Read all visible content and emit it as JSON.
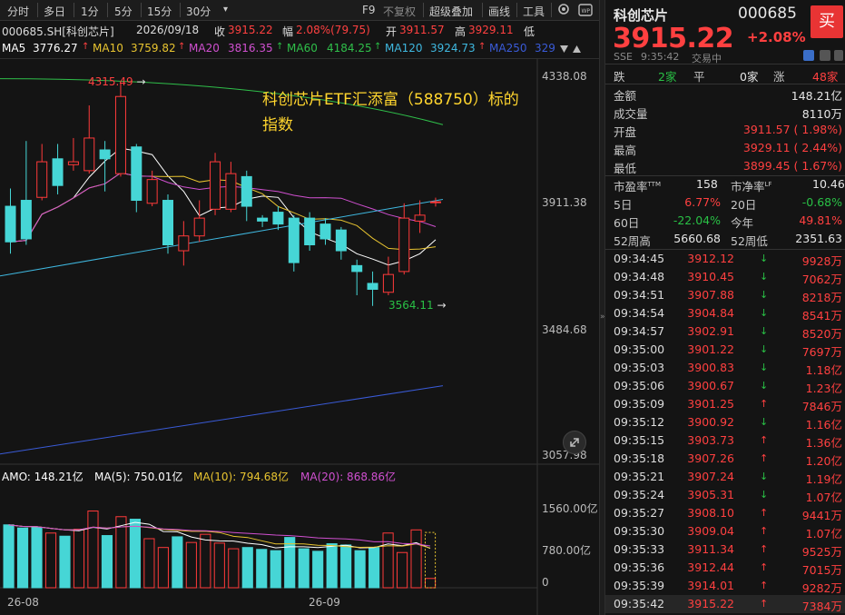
{
  "toolbar": {
    "tabs": [
      "分时",
      "多日",
      "1分",
      "5分",
      "15分",
      "30分"
    ],
    "dropdown": "▾",
    "right": [
      "F9",
      "不复权",
      "超级叠加",
      "画线",
      "工具"
    ]
  },
  "info": {
    "symbol": "000685.SH[科创芯片]",
    "date": "2026/09/18",
    "close_label": "收",
    "close": "3915.22",
    "chg_label": "幅",
    "chg": "2.08%(79.75)",
    "open_label": "开",
    "open": "3911.57",
    "high_label": "高",
    "high": "3929.11",
    "low_label": "低"
  },
  "ma": {
    "ma5_label": "MA5",
    "ma5": "3776.27",
    "ma10_label": "MA10",
    "ma10": "3759.82",
    "ma20_label": "MA20",
    "ma20": "3816.35",
    "ma60_label": "MA60",
    "ma60": "4184.25",
    "ma120_label": "MA120",
    "ma120": "3924.73",
    "ma250_label": "MA250",
    "ma250": "329",
    "arrow": "↑",
    "colors": {
      "ma5": "#ffffff",
      "ma10": "#e8c430",
      "ma20": "#d050d0",
      "ma60": "#2fbf4a",
      "ma120": "#3fb8e0",
      "ma250": "#3a5bd8"
    }
  },
  "chart_data": {
    "type": "candlestick",
    "price_axis": [
      "4338.08",
      "3911.38",
      "3484.68",
      "3057.98"
    ],
    "price_range": [
      3057.98,
      4338.08
    ],
    "max_label": "4315.49",
    "min_label": "3564.11",
    "annotation": "科创芯片ETF汇添富（588750）标的指数",
    "x_labels": [
      "26-08",
      "26-09"
    ],
    "candles": [
      {
        "o": 3900,
        "c": 3780,
        "h": 3960,
        "l": 3740
      },
      {
        "o": 3920,
        "c": 3790,
        "h": 4120,
        "l": 3770
      },
      {
        "o": 3930,
        "c": 4050,
        "h": 4110,
        "l": 3920
      },
      {
        "o": 4060,
        "c": 3970,
        "h": 4110,
        "l": 3940
      },
      {
        "o": 4040,
        "c": 4050,
        "h": 4130,
        "l": 4020
      },
      {
        "o": 4020,
        "c": 4130,
        "h": 4240,
        "l": 4010
      },
      {
        "o": 4090,
        "c": 4060,
        "h": 4120,
        "l": 3950
      },
      {
        "o": 4010,
        "c": 4270,
        "h": 4316,
        "l": 4000
      },
      {
        "o": 4100,
        "c": 3920,
        "h": 4110,
        "l": 3880
      },
      {
        "o": 3910,
        "c": 3990,
        "h": 4020,
        "l": 3900
      },
      {
        "o": 3920,
        "c": 3770,
        "h": 3940,
        "l": 3740
      },
      {
        "o": 3750,
        "c": 3800,
        "h": 3850,
        "l": 3700
      },
      {
        "o": 3800,
        "c": 3860,
        "h": 3920,
        "l": 3780
      },
      {
        "o": 3890,
        "c": 4050,
        "h": 4080,
        "l": 3870
      },
      {
        "o": 3890,
        "c": 4010,
        "h": 4050,
        "l": 3880
      },
      {
        "o": 4000,
        "c": 3900,
        "h": 4020,
        "l": 3850
      },
      {
        "o": 3860,
        "c": 3850,
        "h": 3870,
        "l": 3830
      },
      {
        "o": 3880,
        "c": 3840,
        "h": 3900,
        "l": 3820
      },
      {
        "o": 3860,
        "c": 3710,
        "h": 3870,
        "l": 3680
      },
      {
        "o": 3860,
        "c": 3770,
        "h": 3880,
        "l": 3750
      },
      {
        "o": 3840,
        "c": 3790,
        "h": 3860,
        "l": 3770
      },
      {
        "o": 3820,
        "c": 3750,
        "h": 3830,
        "l": 3720
      },
      {
        "o": 3700,
        "c": 3680,
        "h": 3720,
        "l": 3600
      },
      {
        "o": 3640,
        "c": 3620,
        "h": 3680,
        "l": 3564
      },
      {
        "o": 3610,
        "c": 3670,
        "h": 3730,
        "l": 3600
      },
      {
        "o": 3680,
        "c": 3860,
        "h": 3910,
        "l": 3670
      },
      {
        "o": 3850,
        "c": 3870,
        "h": 3920,
        "l": 3810
      },
      {
        "o": 3912,
        "c": 3915,
        "h": 3929,
        "l": 3899
      }
    ]
  },
  "amo": {
    "label": "AMO: 148.21亿",
    "ma5": "MA(5): 750.01亿",
    "ma10": "MA(10): 794.68亿",
    "ma20": "MA(20): 868.86亿",
    "axis": [
      "1560.00亿",
      "780.00亿",
      "0"
    ],
    "range_max": 1560,
    "bars": [
      1000,
      950,
      960,
      870,
      820,
      930,
      1220,
      830,
      1130,
      1090,
      780,
      640,
      810,
      720,
      850,
      710,
      620,
      640,
      610,
      590,
      800,
      620,
      580,
      700,
      680,
      590,
      640,
      870,
      560,
      920,
      148
    ],
    "colors": {
      "amo": "#ffffff",
      "ma5": "#ffffff",
      "ma10": "#e8c430",
      "ma20": "#d050d0"
    }
  },
  "quote": {
    "name": "科创芯片",
    "code": "000685",
    "buy": "买",
    "price": "3915.22",
    "pct": "+2.08%",
    "exch": "SSE",
    "time": "9:35:42",
    "status": "交易中",
    "breadth": {
      "down_label": "跌",
      "down": "2家",
      "flat_label": "平",
      "flat": "0家",
      "up_label": "涨",
      "up": "48家"
    },
    "stats": [
      {
        "label": "金额",
        "value": "148.21亿",
        "cls": "wht"
      },
      {
        "label": "成交量",
        "value": "8110万",
        "cls": "wht"
      },
      {
        "label": "开盘",
        "value": "3911.57 ( 1.98%)",
        "cls": "red"
      },
      {
        "label": "最高",
        "value": "3929.11 ( 2.44%)",
        "cls": "red"
      },
      {
        "label": "最低",
        "value": "3899.45 ( 1.67%)",
        "cls": "red"
      }
    ],
    "val": {
      "pe_label": "市盈率",
      "pe_sup": "TTM",
      "pe": "158",
      "pb_label": "市净率",
      "pb_sup": "LF",
      "pb": "10.46"
    },
    "perf": [
      {
        "l1": "5日",
        "v1": "6.77%",
        "c1": "red",
        "l2": "20日",
        "v2": "-0.68%",
        "c2": "grn"
      },
      {
        "l1": "60日",
        "v1": "-22.04%",
        "c1": "grn",
        "l2": "今年",
        "v2": "49.81%",
        "c2": "red"
      },
      {
        "l1": "52周高",
        "v1": "5660.68",
        "c1": "wht",
        "l2": "52周低",
        "v2": "2351.63",
        "c2": "wht"
      }
    ],
    "ticks": [
      {
        "t": "09:34:45",
        "p": "3912.12",
        "d": "↓",
        "v": "9928万"
      },
      {
        "t": "09:34:48",
        "p": "3910.45",
        "d": "↓",
        "v": "7062万"
      },
      {
        "t": "09:34:51",
        "p": "3907.88",
        "d": "↓",
        "v": "8218万"
      },
      {
        "t": "09:34:54",
        "p": "3904.84",
        "d": "↓",
        "v": "8541万"
      },
      {
        "t": "09:34:57",
        "p": "3902.91",
        "d": "↓",
        "v": "8520万"
      },
      {
        "t": "09:35:00",
        "p": "3901.22",
        "d": "↓",
        "v": "7697万"
      },
      {
        "t": "09:35:03",
        "p": "3900.83",
        "d": "↓",
        "v": "1.18亿"
      },
      {
        "t": "09:35:06",
        "p": "3900.67",
        "d": "↓",
        "v": "1.23亿"
      },
      {
        "t": "09:35:09",
        "p": "3901.25",
        "d": "↑",
        "v": "7846万"
      },
      {
        "t": "09:35:12",
        "p": "3900.92",
        "d": "↓",
        "v": "1.16亿"
      },
      {
        "t": "09:35:15",
        "p": "3903.73",
        "d": "↑",
        "v": "1.36亿"
      },
      {
        "t": "09:35:18",
        "p": "3907.26",
        "d": "↑",
        "v": "1.20亿"
      },
      {
        "t": "09:35:21",
        "p": "3907.24",
        "d": "↓",
        "v": "1.19亿"
      },
      {
        "t": "09:35:24",
        "p": "3905.31",
        "d": "↓",
        "v": "1.07亿"
      },
      {
        "t": "09:35:27",
        "p": "3908.10",
        "d": "↑",
        "v": "9441万"
      },
      {
        "t": "09:35:30",
        "p": "3909.04",
        "d": "↑",
        "v": "1.07亿"
      },
      {
        "t": "09:35:33",
        "p": "3911.34",
        "d": "↑",
        "v": "9525万"
      },
      {
        "t": "09:35:36",
        "p": "3912.44",
        "d": "↑",
        "v": "7015万"
      },
      {
        "t": "09:35:39",
        "p": "3914.01",
        "d": "↑",
        "v": "9282万"
      },
      {
        "t": "09:35:42",
        "p": "3915.22",
        "d": "↑",
        "v": "7384万"
      }
    ]
  }
}
